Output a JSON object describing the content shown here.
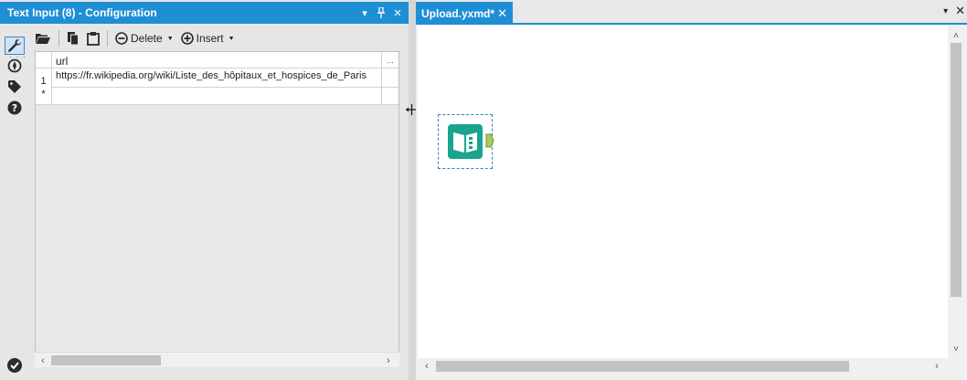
{
  "config_panel": {
    "title": "Text Input (8) - Configuration",
    "controls": {
      "dropdown": "▾",
      "pin": "⊥",
      "close": "✕"
    },
    "toolbar": {
      "delete_label": "Delete",
      "insert_label": "Insert"
    },
    "side_dots": "· · ·",
    "grid": {
      "column_header": "url",
      "header_ellipsis": "...",
      "rows": [
        {
          "num": "1",
          "url": "https://fr.wikipedia.org/wiki/Liste_des_hôpitaux_et_hospices_de_Paris"
        }
      ],
      "new_row_marker": "*"
    }
  },
  "canvas_panel": {
    "tab_label": "Upload.yxmd*",
    "tab_close": "✕",
    "tabbar_dropdown": "▾",
    "tabbar_close": "✕"
  },
  "colors": {
    "accent": "#1e8fd4",
    "tool_teal": "#1aa38f",
    "anchor_green": "#a9cf5a"
  }
}
